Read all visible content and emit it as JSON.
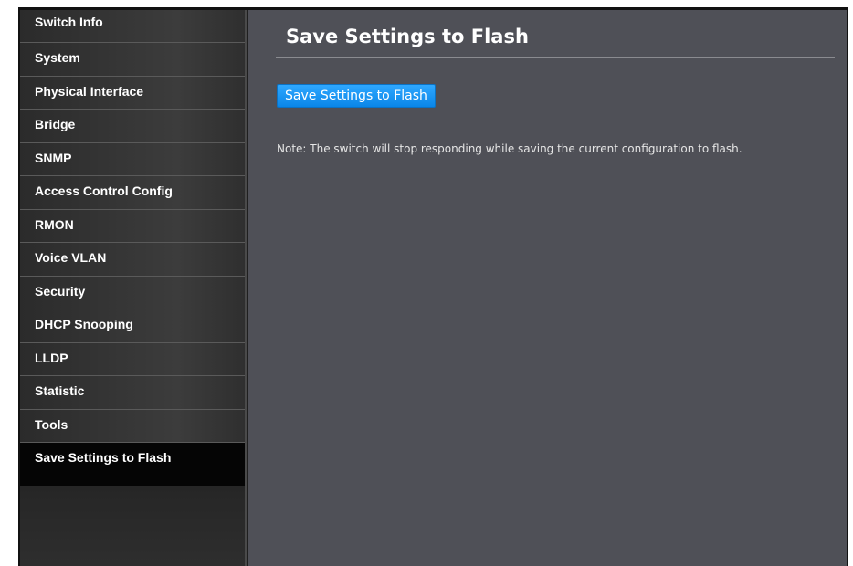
{
  "sidebar": {
    "items": [
      {
        "label": "Switch Info"
      },
      {
        "label": "System"
      },
      {
        "label": "Physical Interface"
      },
      {
        "label": "Bridge"
      },
      {
        "label": "SNMP"
      },
      {
        "label": "Access Control Config"
      },
      {
        "label": "RMON"
      },
      {
        "label": "Voice VLAN"
      },
      {
        "label": "Security"
      },
      {
        "label": "DHCP Snooping"
      },
      {
        "label": "LLDP"
      },
      {
        "label": "Statistic"
      },
      {
        "label": "Tools"
      },
      {
        "label": "Save Settings to Flash",
        "active": true
      }
    ]
  },
  "main": {
    "title": "Save Settings to Flash",
    "save_button_label": "Save Settings to Flash",
    "note": "Note: The switch will stop responding while saving the current configuration to flash."
  },
  "colors": {
    "accent_button": "#1a96f0",
    "content_background": "#4f5057",
    "sidebar_background": "#333333",
    "active_item_background": "#050505"
  }
}
